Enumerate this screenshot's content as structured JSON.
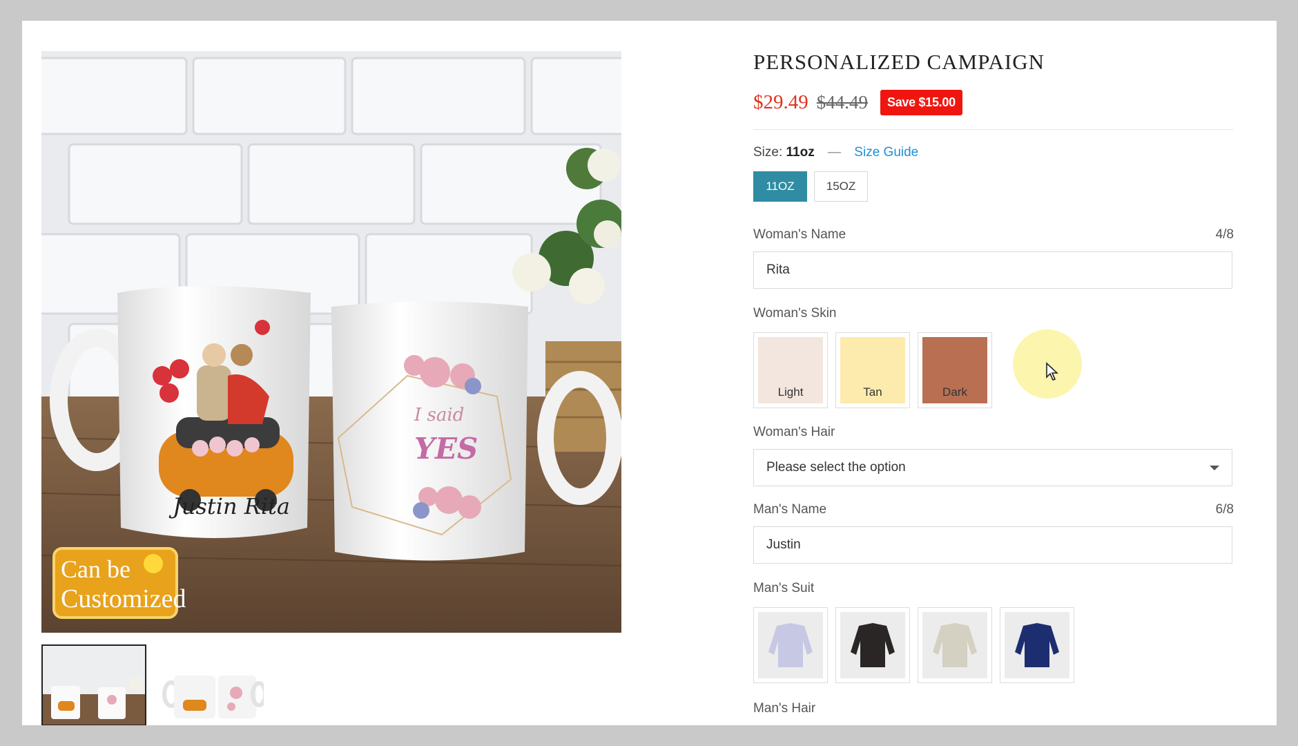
{
  "product": {
    "title": "PERSONALIZED CAMPAIGN",
    "price_now": "$29.49",
    "price_was": "$44.49",
    "save_badge": "Save $15.00"
  },
  "image": {
    "badge_line1": "Can be",
    "badge_line2": "Customized",
    "mug_names": "Justin  Rita",
    "mug_phrase_1": "I said",
    "mug_phrase_2": "YES"
  },
  "size": {
    "label": "Size:",
    "value": "11oz",
    "dash": "—",
    "guide": "Size Guide",
    "options": [
      {
        "label": "11OZ",
        "selected": true
      },
      {
        "label": "15OZ",
        "selected": false
      }
    ]
  },
  "woman_name": {
    "label": "Woman's Name",
    "counter": "4/8",
    "value": "Rita"
  },
  "woman_skin": {
    "label": "Woman's Skin",
    "options": [
      {
        "label": "Light",
        "color": "#f3e6de"
      },
      {
        "label": "Tan",
        "color": "#fdebad"
      },
      {
        "label": "Dark",
        "color": "#b86f52"
      }
    ]
  },
  "woman_hair": {
    "label": "Woman's Hair",
    "placeholder": "Please select the option"
  },
  "man_name": {
    "label": "Man's Name",
    "counter": "6/8",
    "value": "Justin"
  },
  "man_suit": {
    "label": "Man's Suit",
    "options": [
      {
        "name": "lavender-suit",
        "color": "#c7c8e3"
      },
      {
        "name": "black-suit",
        "color": "#2a2626"
      },
      {
        "name": "beige-suit",
        "color": "#d4d0c2"
      },
      {
        "name": "navy-suit",
        "color": "#1d2e70"
      }
    ]
  },
  "man_hair": {
    "label": "Man's Hair"
  },
  "colors": {
    "accent": "#2f8ca3",
    "sale": "#e0321f",
    "badge": "#f0160f",
    "link": "#1f8fd6"
  }
}
